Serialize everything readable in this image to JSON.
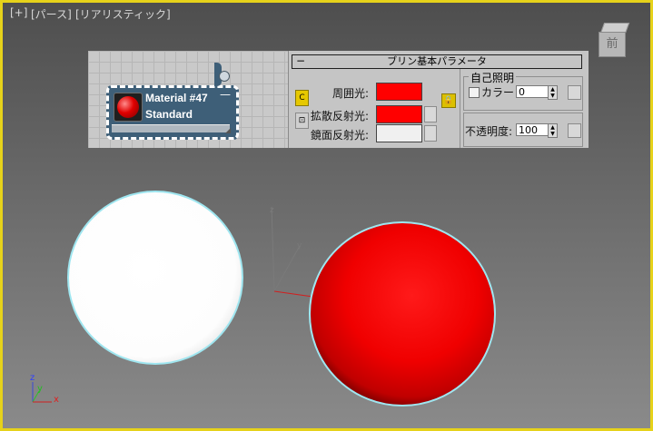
{
  "viewport": {
    "label_plus": "[+]",
    "label_view": "[パース]",
    "label_shading": "[リアリスティック]",
    "border_color": "#e6d21a",
    "viewcube_face": "前"
  },
  "material_node": {
    "name": "Material #47",
    "type": "Standard",
    "collapse_symbol": "—"
  },
  "parameters": {
    "rollout_toggle": "−",
    "rollout_title": "ブリン基本パラメータ",
    "ambient_label": "周囲光:",
    "diffuse_label": "拡散反射光:",
    "specular_label": "鏡面反射光:",
    "ambient_color": "#ff0000",
    "diffuse_color": "#ff0000",
    "specular_color": "#f0f0f0",
    "self_illumination_title": "自己照明",
    "color_label": "カラー",
    "self_illum_value": "0",
    "opacity_label": "不透明度:",
    "opacity_value": "100"
  },
  "axis_gizmo": {
    "z": "z",
    "y": "y",
    "x": "x"
  },
  "scene": {
    "white_sphere_color": "#ffffff",
    "red_sphere_color": "#ff0000",
    "selection_outline_color": "#9fe6f0"
  }
}
